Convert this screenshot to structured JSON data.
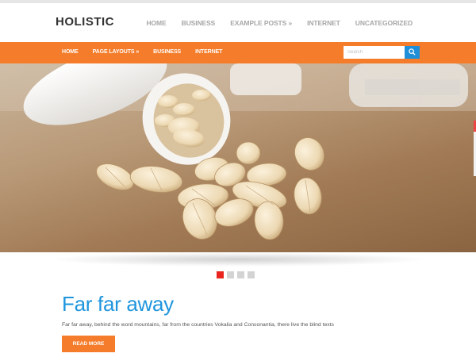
{
  "brand": {
    "logo_text": "HOLISTIC",
    "logo_tagline": "· · · · · · ·"
  },
  "top_nav": [
    "HOME",
    "BUSINESS",
    "EXAMPLE POSTS »",
    "INTERNET",
    "UNCATEGORIZED"
  ],
  "main_nav": [
    "HOME",
    "PAGE LAYOUTS »",
    "BUSINESS",
    "INTERNET"
  ],
  "search": {
    "placeholder": "Search"
  },
  "slider": {
    "dot_count": 4,
    "active_index": 0
  },
  "post": {
    "title": "Far far away",
    "excerpt": "Far far away, behind the word mountains, far from the countries Vokalia and Consonantia, there live the blind texts",
    "button_label": "READ MORE"
  },
  "colors": {
    "accent_orange": "#f57c2a",
    "title_blue": "#1e95dd",
    "search_blue": "#1e8fd8",
    "active_dot": "#e8251f"
  }
}
